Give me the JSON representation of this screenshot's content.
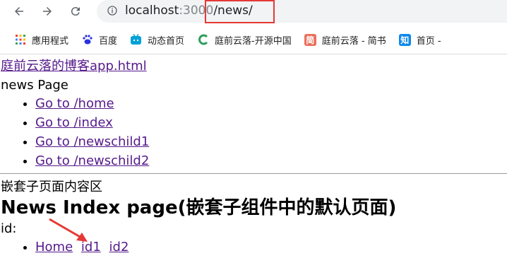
{
  "browser": {
    "url_host": "localhost",
    "url_port": ":3000",
    "url_path": "/news/",
    "bookmarks": [
      {
        "icon": "apps-grid-icon",
        "label": "應用程式",
        "color": "#4285f4"
      },
      {
        "icon": "baidu-paw-icon",
        "label": "百度",
        "color": "#2932e1"
      },
      {
        "icon": "bilibili-tv-icon",
        "label": "动态首页",
        "color": "#00a1d6"
      },
      {
        "icon": "oschina-c-icon",
        "label": "庭前云落-开源中国",
        "color": "#2e9e5b"
      },
      {
        "icon": "jianshu-jian-icon",
        "label": "庭前云落 - 简书",
        "color": "#ea6f5a"
      },
      {
        "icon": "zhihu-zhi-icon",
        "label": "首页 -",
        "color": "#0f88eb"
      }
    ],
    "jianshu_glyph": "简",
    "zhihu_glyph": "知"
  },
  "page": {
    "title_link": "庭前云落的博客app.html",
    "heading": "news Page",
    "nav_links": [
      "Go to /home",
      "Go to /index",
      "Go to /newschild1",
      "Go to /newschild2"
    ],
    "nested_label": "嵌套子页面内容区",
    "nested_heading": "News Index page(嵌套子组件中的默认页面)",
    "id_label": "id:",
    "inline_links": [
      "Home",
      "id1",
      "id2"
    ]
  }
}
